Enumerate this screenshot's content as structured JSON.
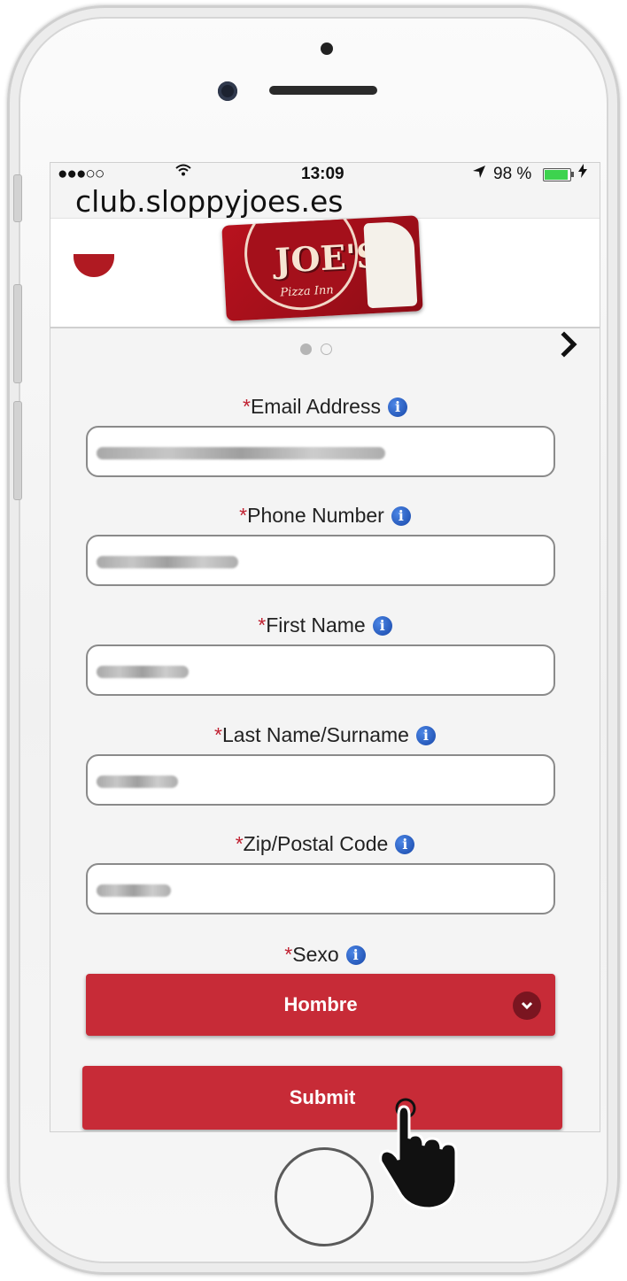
{
  "status_bar": {
    "signal": "●●●○○",
    "wifi_icon": "wifi-icon",
    "time": "13:09",
    "location_icon": "location-arrow-icon",
    "battery": "98 %",
    "battery_icon": "battery-icon",
    "charging_icon": "bolt-icon"
  },
  "url_overlay": "club.sloppyjoes.es",
  "brand": {
    "logo_text": "Sloppy Joe's",
    "logo_sub": "Pizza Inn",
    "logo_text_visible": "JOE'S",
    "accent_color": "#c72b37"
  },
  "carousel": {
    "pages": 2,
    "active_page": 1,
    "next_icon": "chevron-right-icon"
  },
  "form": {
    "required_marker": "*",
    "info_icon": "info-icon",
    "fields": [
      {
        "label": "Email Address",
        "value": "[redacted]"
      },
      {
        "label": "Phone Number",
        "value": "[redacted]"
      },
      {
        "label": "First Name",
        "value": "[redacted]"
      },
      {
        "label": "Last Name/Surname",
        "value": "[redacted]"
      },
      {
        "label": "Zip/Postal Code",
        "value": "[redacted]"
      }
    ],
    "select": {
      "label": "Sexo",
      "selected": "Hombre",
      "caret_icon": "chevron-down-icon"
    },
    "submit_label": "Submit"
  },
  "cursor_icon": "hand-pointer-icon"
}
